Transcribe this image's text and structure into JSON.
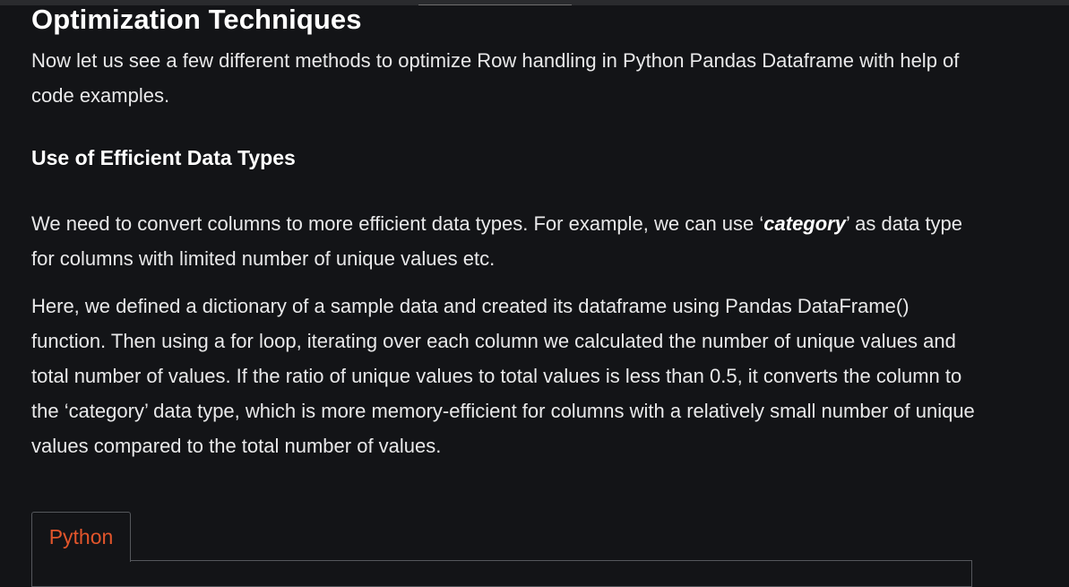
{
  "article": {
    "section_title": "Optimization Techniques",
    "intro_text": "Now let us see a few different methods to optimize Row handling in Python Pandas Dataframe with help of code examples.",
    "subheading": "Use of Efficient Data Types",
    "para1_before": "We need to convert columns to more efficient data types. For example, we can use ‘",
    "para1_emphasis": "category",
    "para1_after": "’ as data type for columns with limited number of unique values etc.",
    "para2": "Here, we defined a dictionary of a sample data and created its dataframe using Pandas DataFrame() function. Then using a for loop, iterating over each column we calculated the number of unique values and total number of values. If the ratio of unique values to total values is less than 0.5, it converts the column to the ‘category’ data type, which is more memory-efficient for columns with a relatively small number of unique values compared to the total number of values."
  },
  "code_block": {
    "tab_label": "Python"
  },
  "colors": {
    "background": "#131417",
    "text": "#e9e9ea",
    "tab_label": "#e2552b",
    "border": "#55575c"
  }
}
